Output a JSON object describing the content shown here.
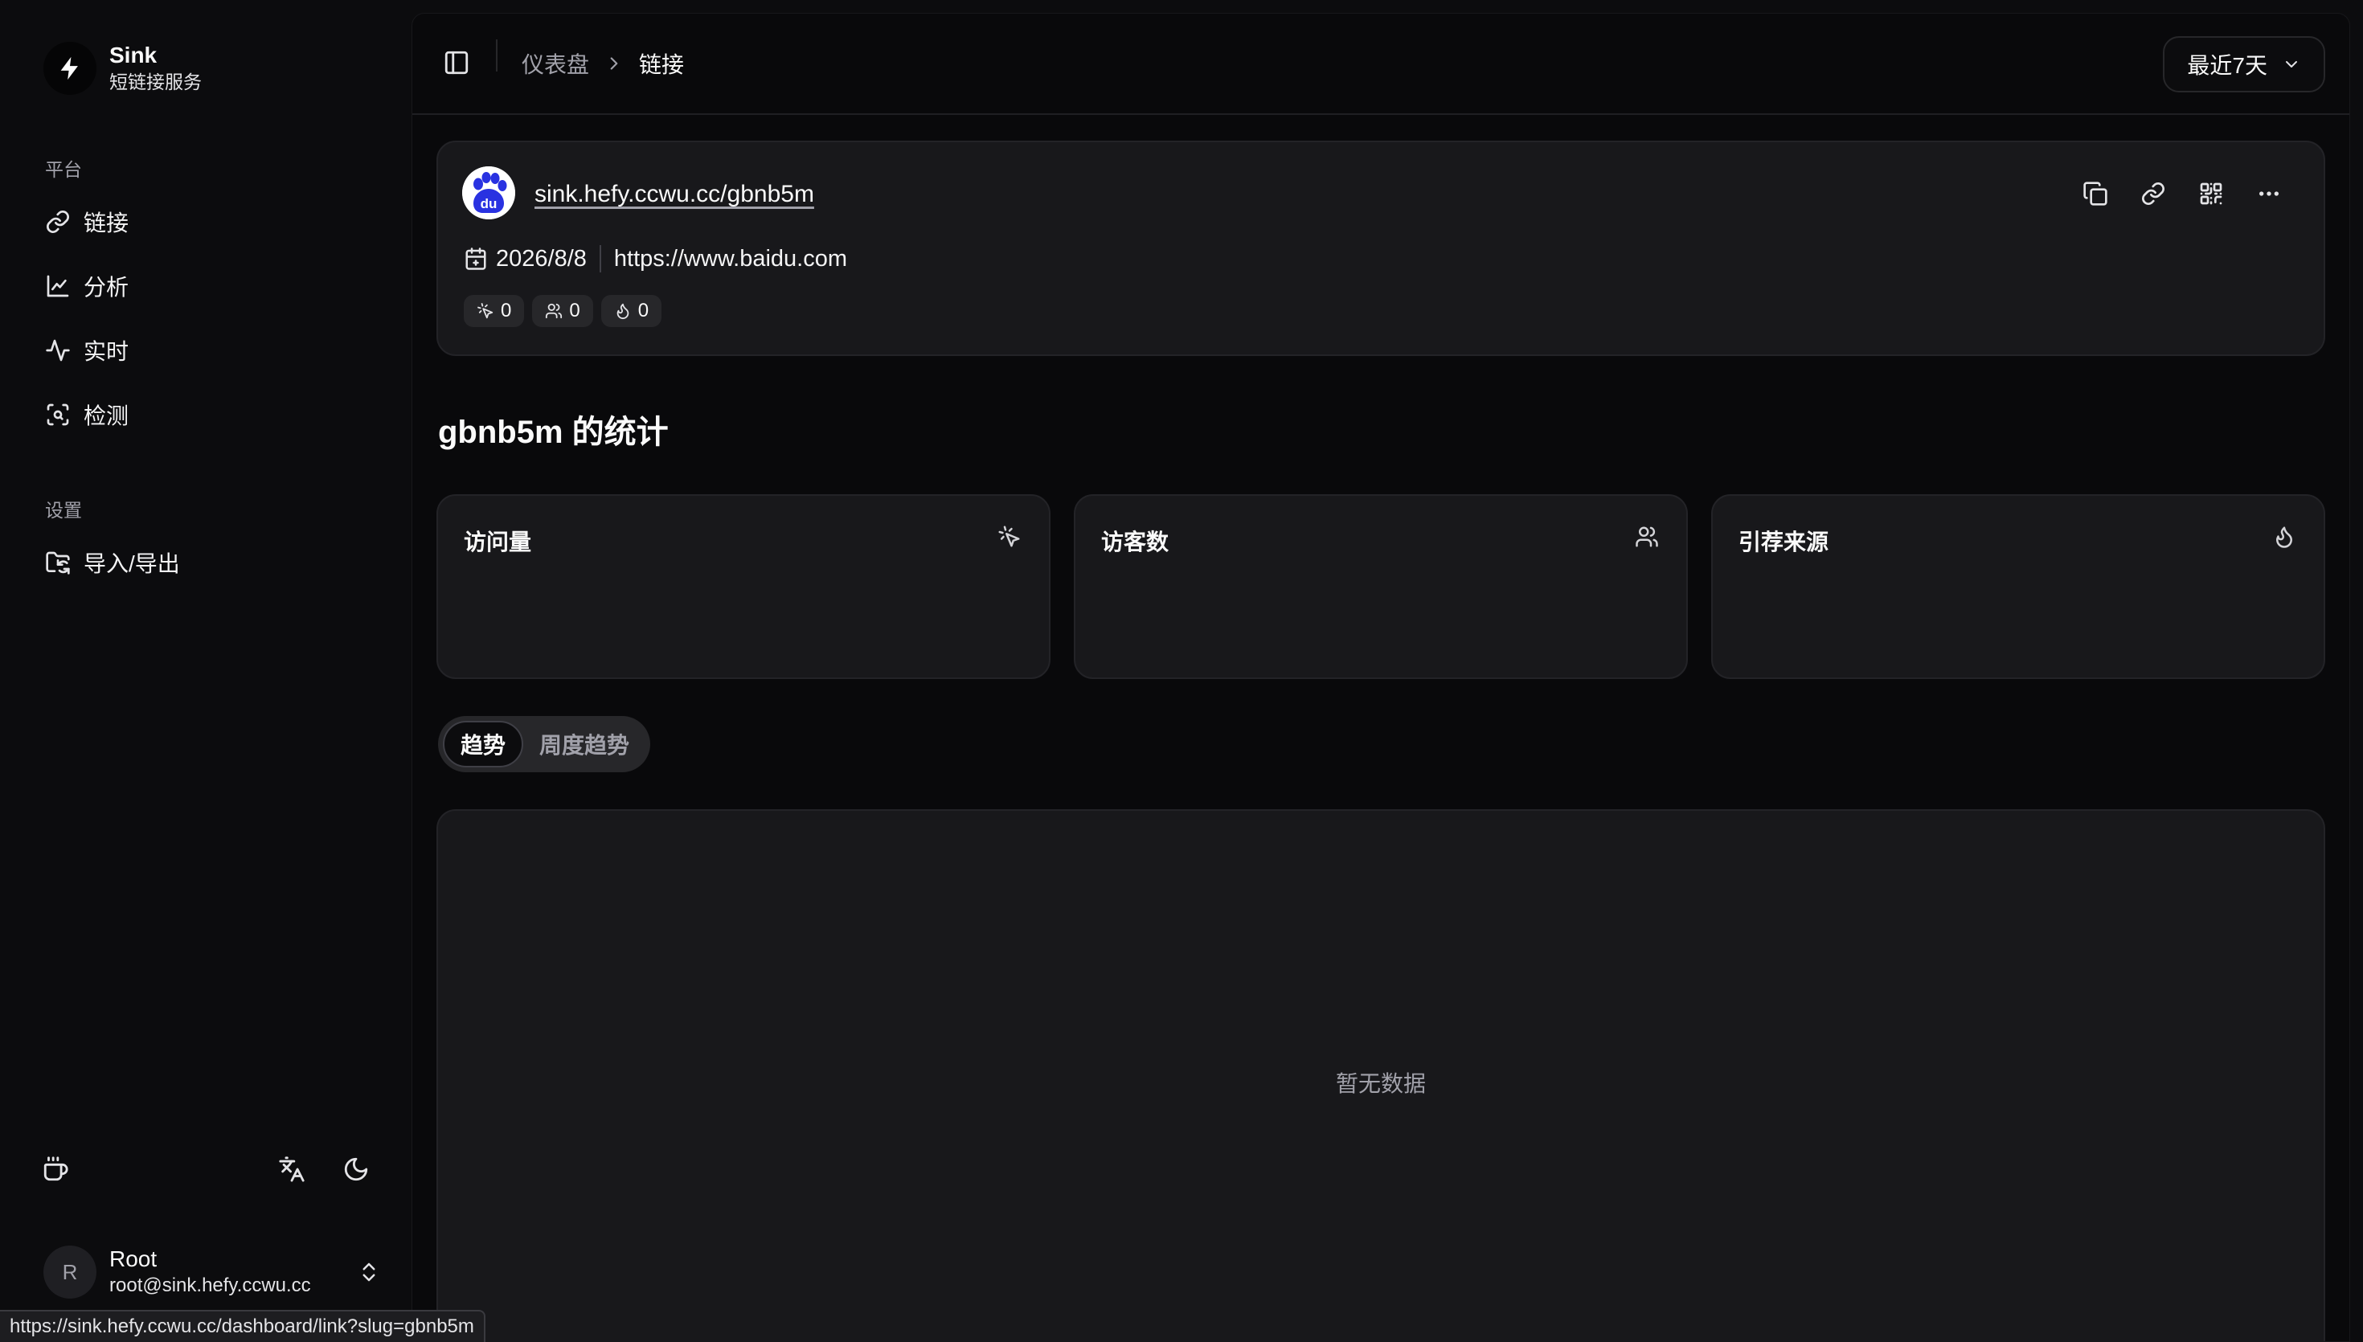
{
  "brand": {
    "name": "Sink",
    "subtitle": "短链接服务"
  },
  "sidebar": {
    "platform_label": "平台",
    "platform_items": [
      {
        "label": "链接",
        "icon": "link-icon"
      },
      {
        "label": "分析",
        "icon": "chart-icon"
      },
      {
        "label": "实时",
        "icon": "activity-icon"
      },
      {
        "label": "检测",
        "icon": "scan-search-icon"
      }
    ],
    "settings_label": "设置",
    "settings_items": [
      {
        "label": "导入/导出",
        "icon": "folder-sync-icon"
      }
    ],
    "footer_icons": [
      "coffee-icon",
      "translate-icon",
      "moon-icon"
    ]
  },
  "user": {
    "initial": "R",
    "name": "Root",
    "email": "root@sink.hefy.ccwu.cc"
  },
  "status_bar_url": "https://sink.hefy.ccwu.cc/dashboard/link?slug=gbnb5m",
  "topbar": {
    "breadcrumb": [
      "仪表盘",
      "链接"
    ],
    "range_select": "最近7天"
  },
  "link": {
    "short_url": "sink.hefy.ccwu.cc/gbnb5m",
    "created_date": "2026/8/8",
    "target_url": "https://www.baidu.com",
    "favicon_text": "du",
    "stats": {
      "visits": "0",
      "visitors": "0",
      "referers": "0"
    }
  },
  "stats_title": "gbnb5m 的统计",
  "cards": [
    {
      "title": "访问量",
      "icon": "mouse-pointer-click-icon"
    },
    {
      "title": "访客数",
      "icon": "users-icon"
    },
    {
      "title": "引荐来源",
      "icon": "flame-icon"
    }
  ],
  "tabs": [
    "趋势",
    "周度趋势"
  ],
  "active_tab": "趋势",
  "chart_empty": "暂无数据"
}
